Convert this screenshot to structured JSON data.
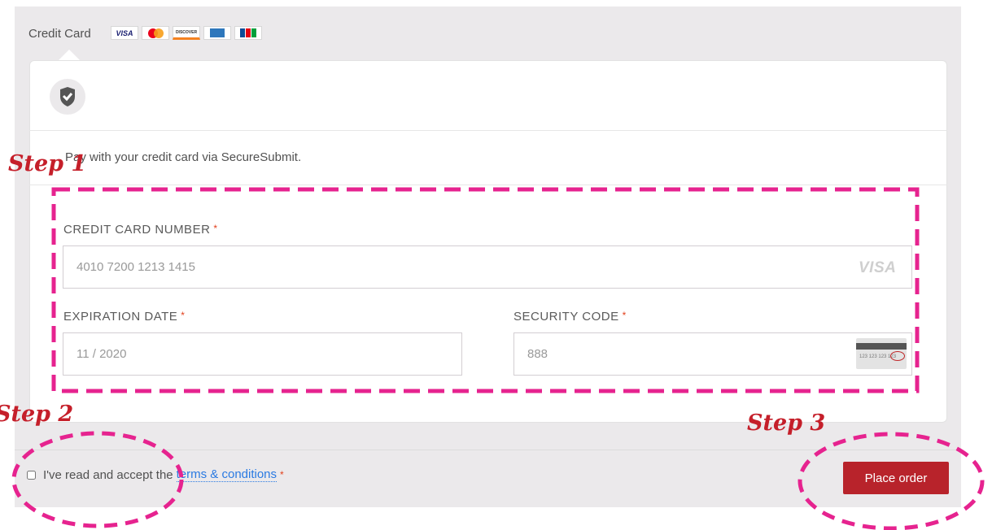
{
  "payment_method": {
    "label": "Credit Card",
    "card_logos": [
      {
        "name": "visa",
        "text": "VISA"
      },
      {
        "name": "mastercard",
        "text": "MasterCard"
      },
      {
        "name": "discover",
        "text": "DISCOVER"
      },
      {
        "name": "amex",
        "text": "AMEX"
      },
      {
        "name": "jcb",
        "text": "JCB"
      }
    ]
  },
  "description": "Pay with your credit card via SecureSubmit.",
  "form": {
    "card_number": {
      "label": "CREDIT CARD NUMBER",
      "required_mark": "*",
      "value": "4010 7200 1213 1415",
      "brand_badge": "VISA"
    },
    "expiration": {
      "label": "EXPIRATION DATE",
      "required_mark": "*",
      "value": "11 / 2020"
    },
    "security_code": {
      "label": "SECURITY CODE",
      "required_mark": "*",
      "value": "888",
      "icon_text": "123 123 123 123"
    }
  },
  "terms": {
    "prefix": "I've read and accept the",
    "link_text": "terms & conditions",
    "required_mark": "*",
    "checked": false
  },
  "place_order": {
    "label": "Place order"
  },
  "annotations": {
    "step1": "Step 1",
    "step2": "Step 2",
    "step3": "Step 3",
    "color": "#e6238f"
  },
  "colors": {
    "panel": "#ebe9eb",
    "button": "#b8232b",
    "link": "#2a7ae2",
    "required": "#e2401c",
    "step_text": "#c51f2a"
  }
}
